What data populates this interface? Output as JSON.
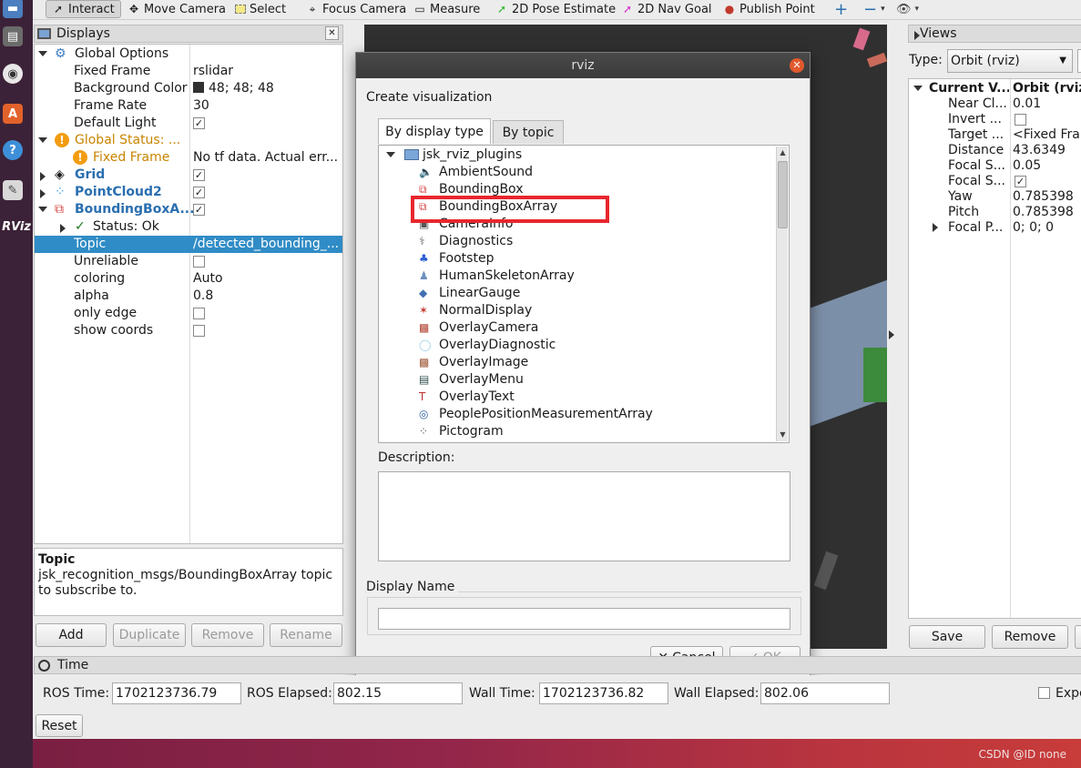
{
  "toolbar": {
    "interact": "Interact",
    "move_camera": "Move Camera",
    "select": "Select",
    "focus_camera": "Focus Camera",
    "measure": "Measure",
    "pose_estimate": "2D Pose Estimate",
    "nav_goal": "2D Nav Goal",
    "publish_point": "Publish Point"
  },
  "displays": {
    "title": "Displays",
    "global_options": "Global Options",
    "fixed_frame_label": "Fixed Frame",
    "fixed_frame_value": "rslidar",
    "bg_color_label": "Background Color",
    "bg_color_value": "48; 48; 48",
    "frame_rate_label": "Frame Rate",
    "frame_rate_value": "30",
    "default_light_label": "Default Light",
    "global_status": "Global Status: ...",
    "fixed_frame_err_label": "Fixed Frame",
    "fixed_frame_err_value": "No tf data.  Actual err...",
    "grid": "Grid",
    "pointcloud": "PointCloud2",
    "bbox": "BoundingBoxA...",
    "status_ok": "Status: Ok",
    "topic_label": "Topic",
    "topic_value": "/detected_bounding_...",
    "unreliable": "Unreliable",
    "coloring_label": "coloring",
    "coloring_value": "Auto",
    "alpha_label": "alpha",
    "alpha_value": "0.8",
    "only_edge": "only edge",
    "show_coords": "show coords",
    "desc_title": "Topic",
    "desc_text": "jsk_recognition_msgs/BoundingBoxArray topic to subscribe to.",
    "add": "Add",
    "duplicate": "Duplicate",
    "remove": "Remove",
    "rename": "Rename"
  },
  "dialog": {
    "title": "rviz",
    "create_label": "Create visualization",
    "tab_type": "By display type",
    "tab_topic": "By topic",
    "group": "jsk_rviz_plugins",
    "items": [
      "AmbientSound",
      "BoundingBox",
      "BoundingBoxArray",
      "CameraInfo",
      "Diagnostics",
      "Footstep",
      "HumanSkeletonArray",
      "LinearGauge",
      "NormalDisplay",
      "OverlayCamera",
      "OverlayDiagnostic",
      "OverlayImage",
      "OverlayMenu",
      "OverlayText",
      "PeoplePositionMeasurementArray",
      "Pictogram"
    ],
    "description_label": "Description:",
    "display_name_label": "Display Name",
    "cancel": "Cancel",
    "ok": "OK"
  },
  "views": {
    "title": "Views",
    "type_label": "Type:",
    "type_value": "Orbit (rviz)",
    "current_view": "Current V...",
    "current_view_value": "Orbit (rviz)",
    "rows": [
      {
        "k": "Near Cl...",
        "v": "0.01"
      },
      {
        "k": "Invert ...",
        "v": ""
      },
      {
        "k": "Target ...",
        "v": "<Fixed Frame>"
      },
      {
        "k": "Distance",
        "v": "43.6349"
      },
      {
        "k": "Focal S...",
        "v": "0.05"
      },
      {
        "k": "Focal S...",
        "v": ""
      },
      {
        "k": "Yaw",
        "v": "0.785398"
      },
      {
        "k": "Pitch",
        "v": "0.785398"
      },
      {
        "k": "Focal P...",
        "v": "0; 0; 0"
      }
    ],
    "save": "Save",
    "remove": "Remove"
  },
  "time": {
    "title": "Time",
    "ros_time_label": "ROS Time:",
    "ros_time": "1702123736.79",
    "ros_elapsed_label": "ROS Elapsed:",
    "ros_elapsed": "802.15",
    "wall_time_label": "Wall Time:",
    "wall_time": "1702123736.82",
    "wall_elapsed_label": "Wall Elapsed:",
    "wall_elapsed": "802.06",
    "experimental": "Expe",
    "reset": "Reset"
  },
  "watermark": "CSDN @ID none",
  "launcher_rviz": "RViz",
  "colors": {
    "accent": "#308cc6",
    "redbox": "#e8262d",
    "bg3d": "#303030"
  }
}
